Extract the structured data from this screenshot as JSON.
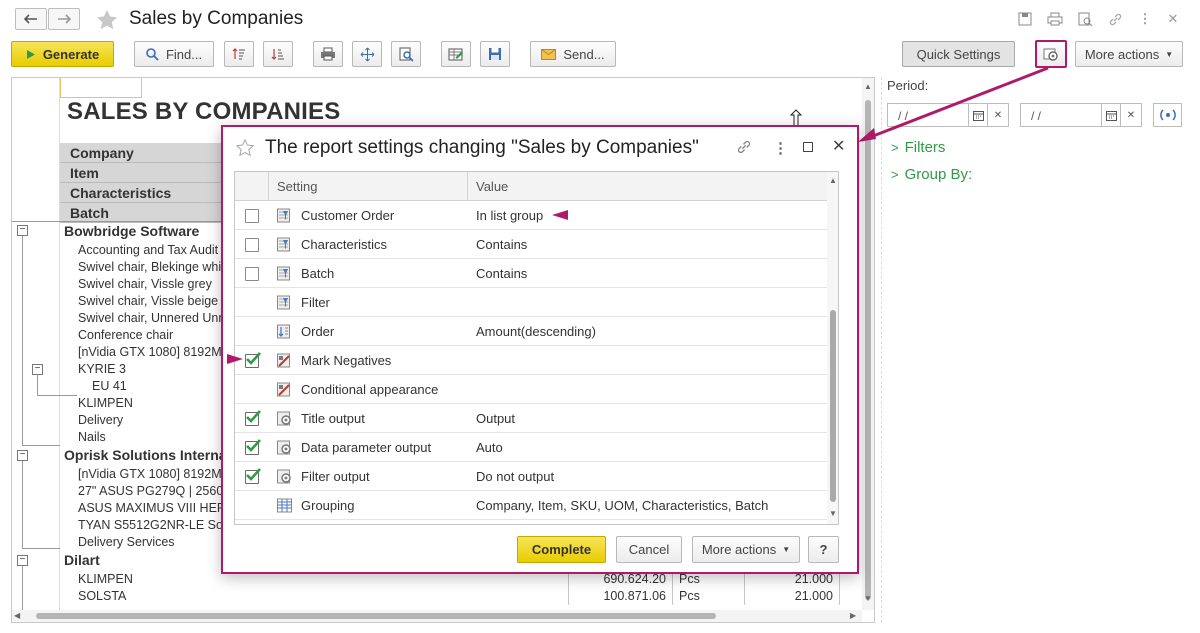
{
  "window": {
    "title": "Sales by Companies"
  },
  "toolbar": {
    "generate": "Generate",
    "find": "Find...",
    "send": "Send...",
    "quick_settings": "Quick Settings",
    "more_actions": "More actions"
  },
  "report": {
    "title": "SALES BY COMPANIES",
    "headers": [
      "Company",
      "Item",
      "Characteristics",
      "Batch"
    ],
    "rows": [
      {
        "text": "Bowbridge Software",
        "group": true
      },
      {
        "text": "Accounting and Tax Audit"
      },
      {
        "text": "Swivel chair, Blekinge white"
      },
      {
        "text": "Swivel chair, Vissle grey"
      },
      {
        "text": "Swivel chair, Vissle beige"
      },
      {
        "text": "Swivel chair, Unnered Unnered"
      },
      {
        "text": "Conference chair"
      },
      {
        "text": "[nVidia GTX 1080] 8192MB"
      },
      {
        "text": "KYRIE 3"
      },
      {
        "text": "EU 41"
      },
      {
        "text": "KLIMPEN"
      },
      {
        "text": "Delivery"
      },
      {
        "text": "Nails"
      },
      {
        "text": "Oprisk Solutions International",
        "group": true
      },
      {
        "text": "[nVidia GTX 1080] 8192MB"
      },
      {
        "text": "27\" ASUS PG279Q | 2560"
      },
      {
        "text": "ASUS MAXIMUS VIII HERO"
      },
      {
        "text": "TYAN S5512G2NR-LE Socket"
      },
      {
        "text": "Delivery Services"
      },
      {
        "text": "Dilart",
        "group": true
      },
      {
        "text": "KLIMPEN",
        "amount": "690.624.20",
        "uom": "Pcs",
        "qty": "21.000"
      },
      {
        "text": "SOLSTA",
        "amount": "100.871.06",
        "uom": "Pcs",
        "qty": "21.000"
      }
    ]
  },
  "right_panel": {
    "period_label": "Period:",
    "date_from": " /  / ",
    "date_to": " /  / ",
    "filters": "Filters",
    "group_by": "Group By:"
  },
  "dialog": {
    "title": "The report settings changing \"Sales by Companies\"",
    "col_setting": "Setting",
    "col_value": "Value",
    "rows": [
      {
        "name": "Customer Order",
        "value": "In list group",
        "checkbox": "off",
        "icon": "filter-icon"
      },
      {
        "name": "Characteristics",
        "value": "Contains",
        "checkbox": "off",
        "icon": "filter-icon"
      },
      {
        "name": "Batch",
        "value": "Contains",
        "checkbox": "off",
        "icon": "filter-icon"
      },
      {
        "name": "Filter",
        "value": "",
        "checkbox": "none",
        "icon": "filter-icon"
      },
      {
        "name": "Order",
        "value": "Amount(descending)",
        "checkbox": "none",
        "icon": "sort-icon"
      },
      {
        "name": "Mark Negatives",
        "value": "",
        "checkbox": "on",
        "icon": "conditional-icon"
      },
      {
        "name": "Conditional appearance",
        "value": "",
        "checkbox": "none",
        "icon": "conditional-icon"
      },
      {
        "name": "Title output",
        "value": "Output",
        "checkbox": "on",
        "icon": "gear-icon"
      },
      {
        "name": "Data parameter output",
        "value": "Auto",
        "checkbox": "on",
        "icon": "gear-icon"
      },
      {
        "name": "Filter output",
        "value": "Do not output",
        "checkbox": "on",
        "icon": "gear-icon"
      },
      {
        "name": "Grouping",
        "value": "Company, Item, SKU, UOM, Characteristics, Batch",
        "checkbox": "none",
        "icon": "grouping-icon"
      }
    ],
    "complete": "Complete",
    "cancel": "Cancel",
    "more_actions": "More actions",
    "help": "?"
  },
  "colors": {
    "accent_magenta": "#b0196a",
    "check_green": "#2f9b45",
    "primary_yellow": "#f0d800"
  }
}
